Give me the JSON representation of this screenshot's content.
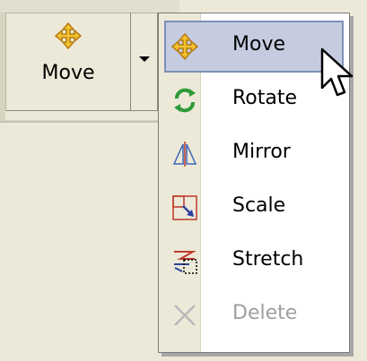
{
  "toolbar": {
    "move_button": {
      "label": "Move",
      "icon": "move-icon"
    },
    "dropdown_arrow": {
      "icon": "dropdown-arrow-icon"
    }
  },
  "menu": {
    "items": [
      {
        "label": "Move",
        "icon": "move-icon",
        "selected": true,
        "enabled": true
      },
      {
        "label": "Rotate",
        "icon": "rotate-icon",
        "enabled": true
      },
      {
        "label": "Mirror",
        "icon": "mirror-icon",
        "enabled": true
      },
      {
        "label": "Scale",
        "icon": "scale-icon",
        "enabled": true
      },
      {
        "label": "Stretch",
        "icon": "stretch-icon",
        "enabled": true
      },
      {
        "label": "Delete",
        "icon": "delete-icon",
        "enabled": false
      }
    ]
  },
  "colors": {
    "panel_bg": "#ece9d8",
    "menu_bg": "#ffffff",
    "selection_bg": "#c6cce0",
    "selection_border": "#7c8fb8",
    "disabled_text": "#9f9f9f"
  }
}
